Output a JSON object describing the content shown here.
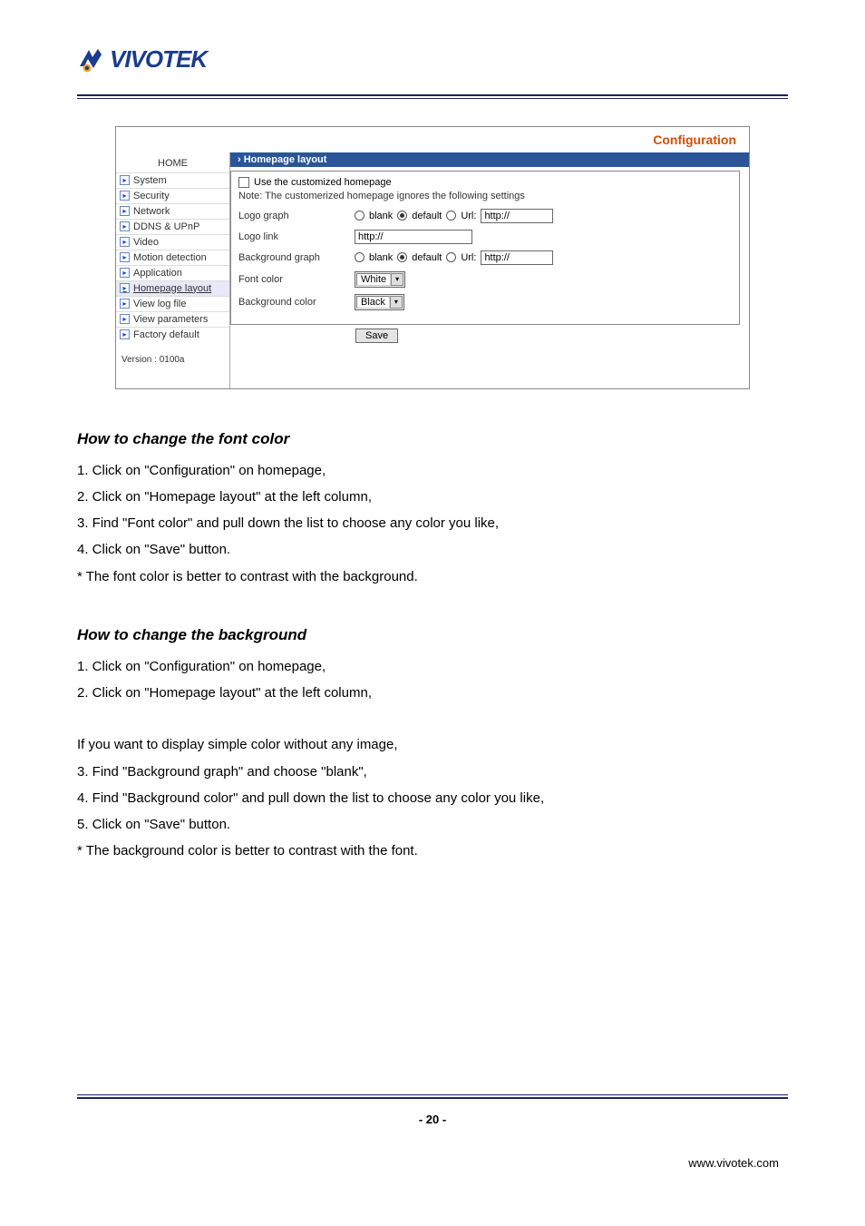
{
  "logo": {
    "text": "VIVOTEK"
  },
  "screenshot": {
    "config_label": "Configuration",
    "section_bar": "Homepage layout",
    "home_link": "HOME",
    "nav": [
      "System",
      "Security",
      "Network",
      "DDNS & UPnP",
      "Video",
      "Motion detection",
      "Application",
      "Homepage layout",
      "View log file",
      "View parameters",
      "Factory default"
    ],
    "nav_active_index": 7,
    "version": "Version : 0100a",
    "checkbox_label": "Use the customized homepage",
    "note": "Note: The customerized homepage ignores the following settings",
    "logo_graph": {
      "label": "Logo graph",
      "opt_blank": "blank",
      "opt_default": "default",
      "opt_url": "Url:",
      "url_value": "http://"
    },
    "logo_link": {
      "label": "Logo link",
      "value": "http://"
    },
    "bg_graph": {
      "label": "Background graph",
      "opt_blank": "blank",
      "opt_default": "default",
      "opt_url": "Url:",
      "url_value": "http://"
    },
    "font_color": {
      "label": "Font color",
      "value": "White"
    },
    "bg_color": {
      "label": "Background color",
      "value": "Black"
    },
    "save": "Save"
  },
  "section1": {
    "heading": "How to change the font color",
    "lines": [
      "1. Click on \"Configuration\" on homepage,",
      "2. Click on \"Homepage layout\" at the left column,",
      "3. Find \"Font color\" and pull down the list to choose any color you like,",
      "4. Click on \"Save\" button.",
      "* The font color is better to contrast with the background."
    ]
  },
  "section2": {
    "heading": "How to change the background",
    "lines": [
      "1. Click on \"Configuration\" on homepage,",
      "2. Click on \"Homepage layout\" at the left column,"
    ],
    "lines2": [
      "If you want to display simple color without any image,",
      "3. Find \"Background graph\" and choose \"blank\",",
      "4. Find \"Background color\" and pull down the list to choose any color you like,",
      "5. Click on \"Save\" button.",
      "* The background color is better to contrast with the font."
    ]
  },
  "page_num": "- 20 -",
  "footer_url": "www.vivotek.com"
}
